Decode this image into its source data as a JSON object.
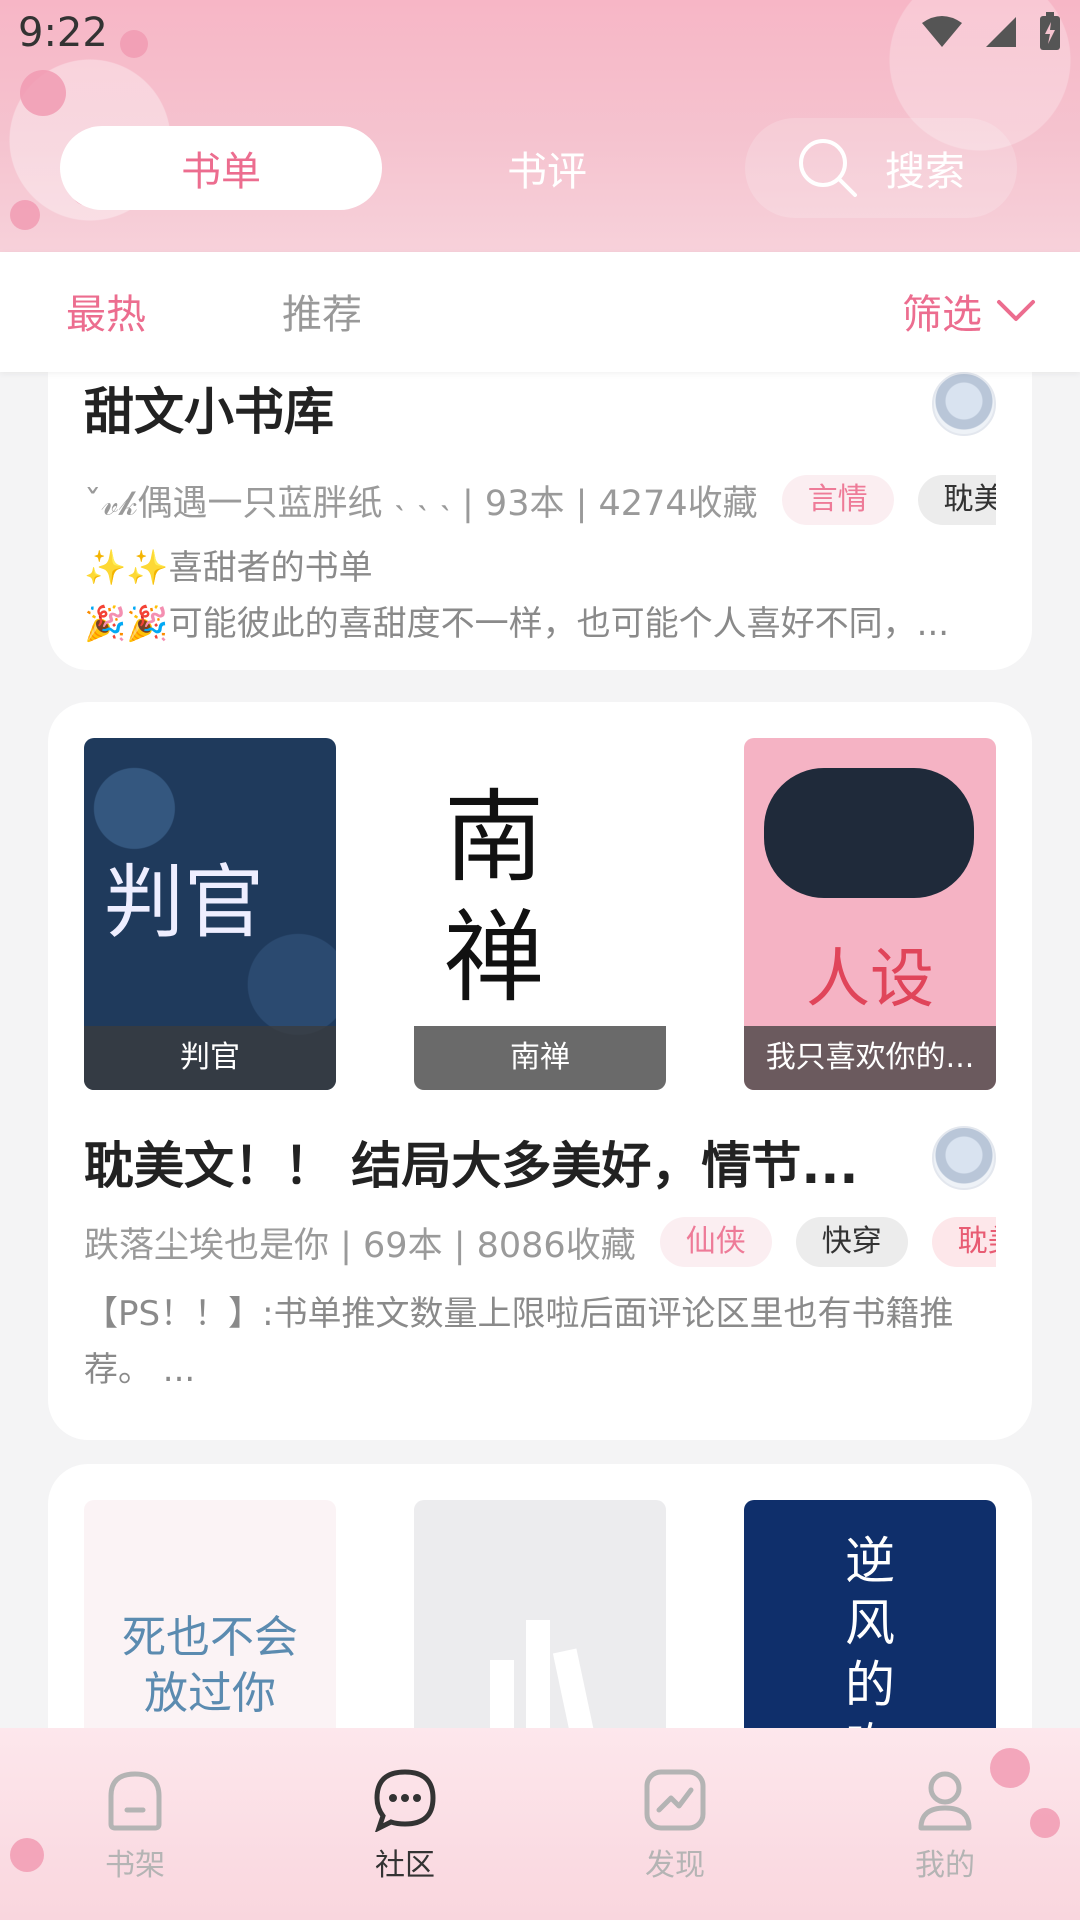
{
  "status_bar": {
    "time": "9:22"
  },
  "header": {
    "tabs": [
      {
        "label": "书单"
      },
      {
        "label": "书评"
      }
    ],
    "search_label": "搜索"
  },
  "subtabs": {
    "items": [
      {
        "label": "最热"
      },
      {
        "label": "推荐"
      }
    ],
    "filter_label": "筛选"
  },
  "cards": [
    {
      "title": "甜文小书库",
      "meta": "ˇ𝓋𝓀偶遇一只蓝胖纸 ˴ ˴ ˴ | 93本 | 4274收藏",
      "tags": [
        "言情",
        "耽美"
      ],
      "desc_line1": "✨✨喜甜者的书单",
      "desc_line2": "🎉🎉可能彼此的喜甜度不一样，也可能个人喜好不同，..."
    },
    {
      "covers": [
        {
          "label": "判官",
          "art_text": "判官"
        },
        {
          "label": "南禅",
          "art_text": "南禅"
        },
        {
          "label": "我只喜欢你的...",
          "art_text": "人设"
        }
      ],
      "title": "耽美文！！ 结局大多美好，情节...",
      "meta": "跌落尘埃也是你 | 69本 | 8086收藏",
      "tags": [
        "仙侠",
        "快穿",
        "耽美"
      ],
      "desc": "【PS！！】:书单推文数量上限啦后面评论区里也有书籍推荐。 ..."
    },
    {
      "covers": [
        {
          "art_text": "死也不会放过你"
        },
        {
          "art_text": ""
        },
        {
          "art_text": "逆风的吻"
        }
      ]
    }
  ],
  "bottom_nav": [
    {
      "label": "书架",
      "icon": "bookshelf-icon"
    },
    {
      "label": "社区",
      "icon": "chat-icon"
    },
    {
      "label": "发现",
      "icon": "trend-icon"
    },
    {
      "label": "我的",
      "icon": "user-icon"
    }
  ],
  "colors": {
    "accent": "#ec6d8f",
    "header_pink": "#f5c3cf"
  }
}
